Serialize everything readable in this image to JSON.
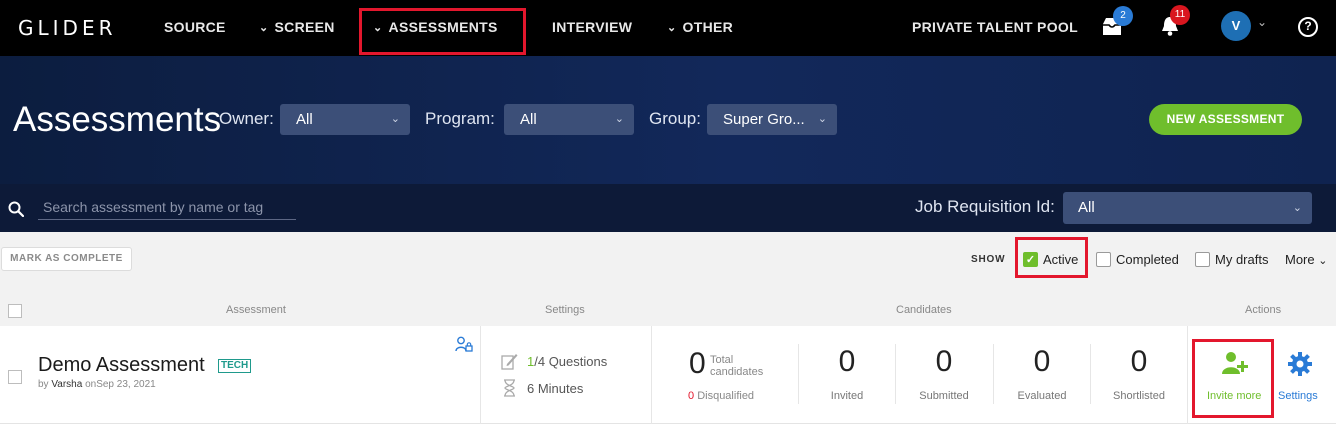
{
  "nav": {
    "logo": "GLIDER",
    "items": [
      {
        "label": "SOURCE",
        "chevron": false
      },
      {
        "label": "SCREEN",
        "chevron": true
      },
      {
        "label": "ASSESSMENTS",
        "chevron": true
      },
      {
        "label": "INTERVIEW",
        "chevron": false
      },
      {
        "label": "OTHER",
        "chevron": true
      }
    ],
    "private_pool": "PRIVATE TALENT POOL",
    "inbox_badge": "2",
    "bell_badge": "11",
    "avatar_initial": "V",
    "help": "?"
  },
  "hero": {
    "title": "Assessments",
    "owner_label": "Owner:",
    "owner_value": "All",
    "program_label": "Program:",
    "program_value": "All",
    "group_label": "Group:",
    "group_value": "Super Gro...",
    "new_button": "NEW ASSESSMENT"
  },
  "search": {
    "placeholder": "Search assessment by name or tag",
    "job_req_label": "Job Requisition Id:",
    "job_req_value": "All"
  },
  "toolbar": {
    "mark_complete": "MARK AS COMPLETE",
    "show_label": "SHOW",
    "filters": [
      {
        "label": "Active",
        "checked": true
      },
      {
        "label": "Completed",
        "checked": false
      },
      {
        "label": "My drafts",
        "checked": false
      }
    ],
    "more": "More"
  },
  "table": {
    "headers": {
      "assessment": "Assessment",
      "settings": "Settings",
      "candidates": "Candidates",
      "actions": "Actions"
    },
    "row": {
      "name": "Demo Assessment",
      "tag": "TECH",
      "by_prefix": "by",
      "author": "Varsha",
      "on_prefix": "on",
      "date": "Sep 23, 2021",
      "questions_done": "1",
      "questions_rest": "/4 Questions",
      "duration": "6 Minutes",
      "total": "0",
      "total_label_1": "Total",
      "total_label_2": "candidates",
      "disqualified_count": "0",
      "disqualified_label": "Disqualified",
      "stats": [
        {
          "value": "0",
          "label": "Invited"
        },
        {
          "value": "0",
          "label": "Submitted"
        },
        {
          "value": "0",
          "label": "Evaluated"
        },
        {
          "value": "0",
          "label": "Shortlisted"
        }
      ],
      "invite_label": "Invite more",
      "settings_label": "Settings"
    }
  }
}
